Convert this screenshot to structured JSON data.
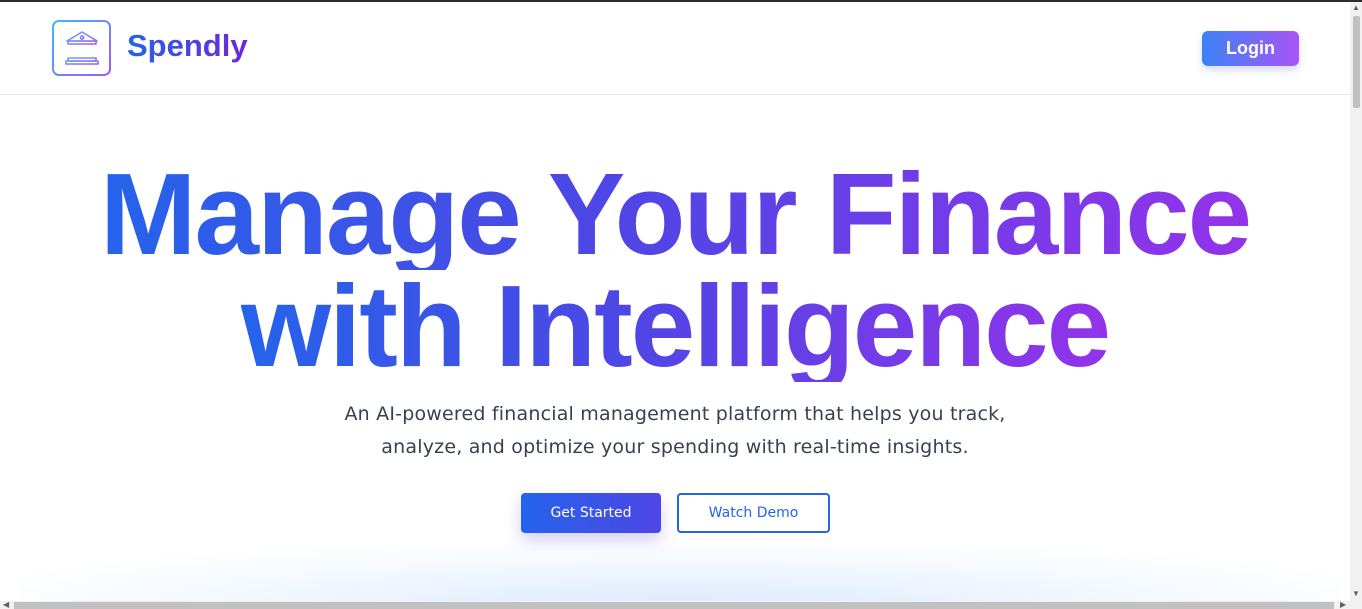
{
  "header": {
    "brand": "Spendly",
    "logo_icon": "bank-building-icon",
    "login_label": "Login"
  },
  "hero": {
    "title_line1": "Manage Your Finance",
    "title_line2": "with Intelligence",
    "subtitle_line1": "An AI-powered financial management platform that helps you track,",
    "subtitle_line2": "analyze, and optimize your spending with real-time insights.",
    "primary_cta": "Get Started",
    "secondary_cta": "Watch Demo"
  },
  "colors": {
    "brand_blue": "#2563eb",
    "brand_purple": "#9333ea",
    "accent_gradient_start": "#3b82f6",
    "accent_gradient_end": "#a855f7"
  }
}
